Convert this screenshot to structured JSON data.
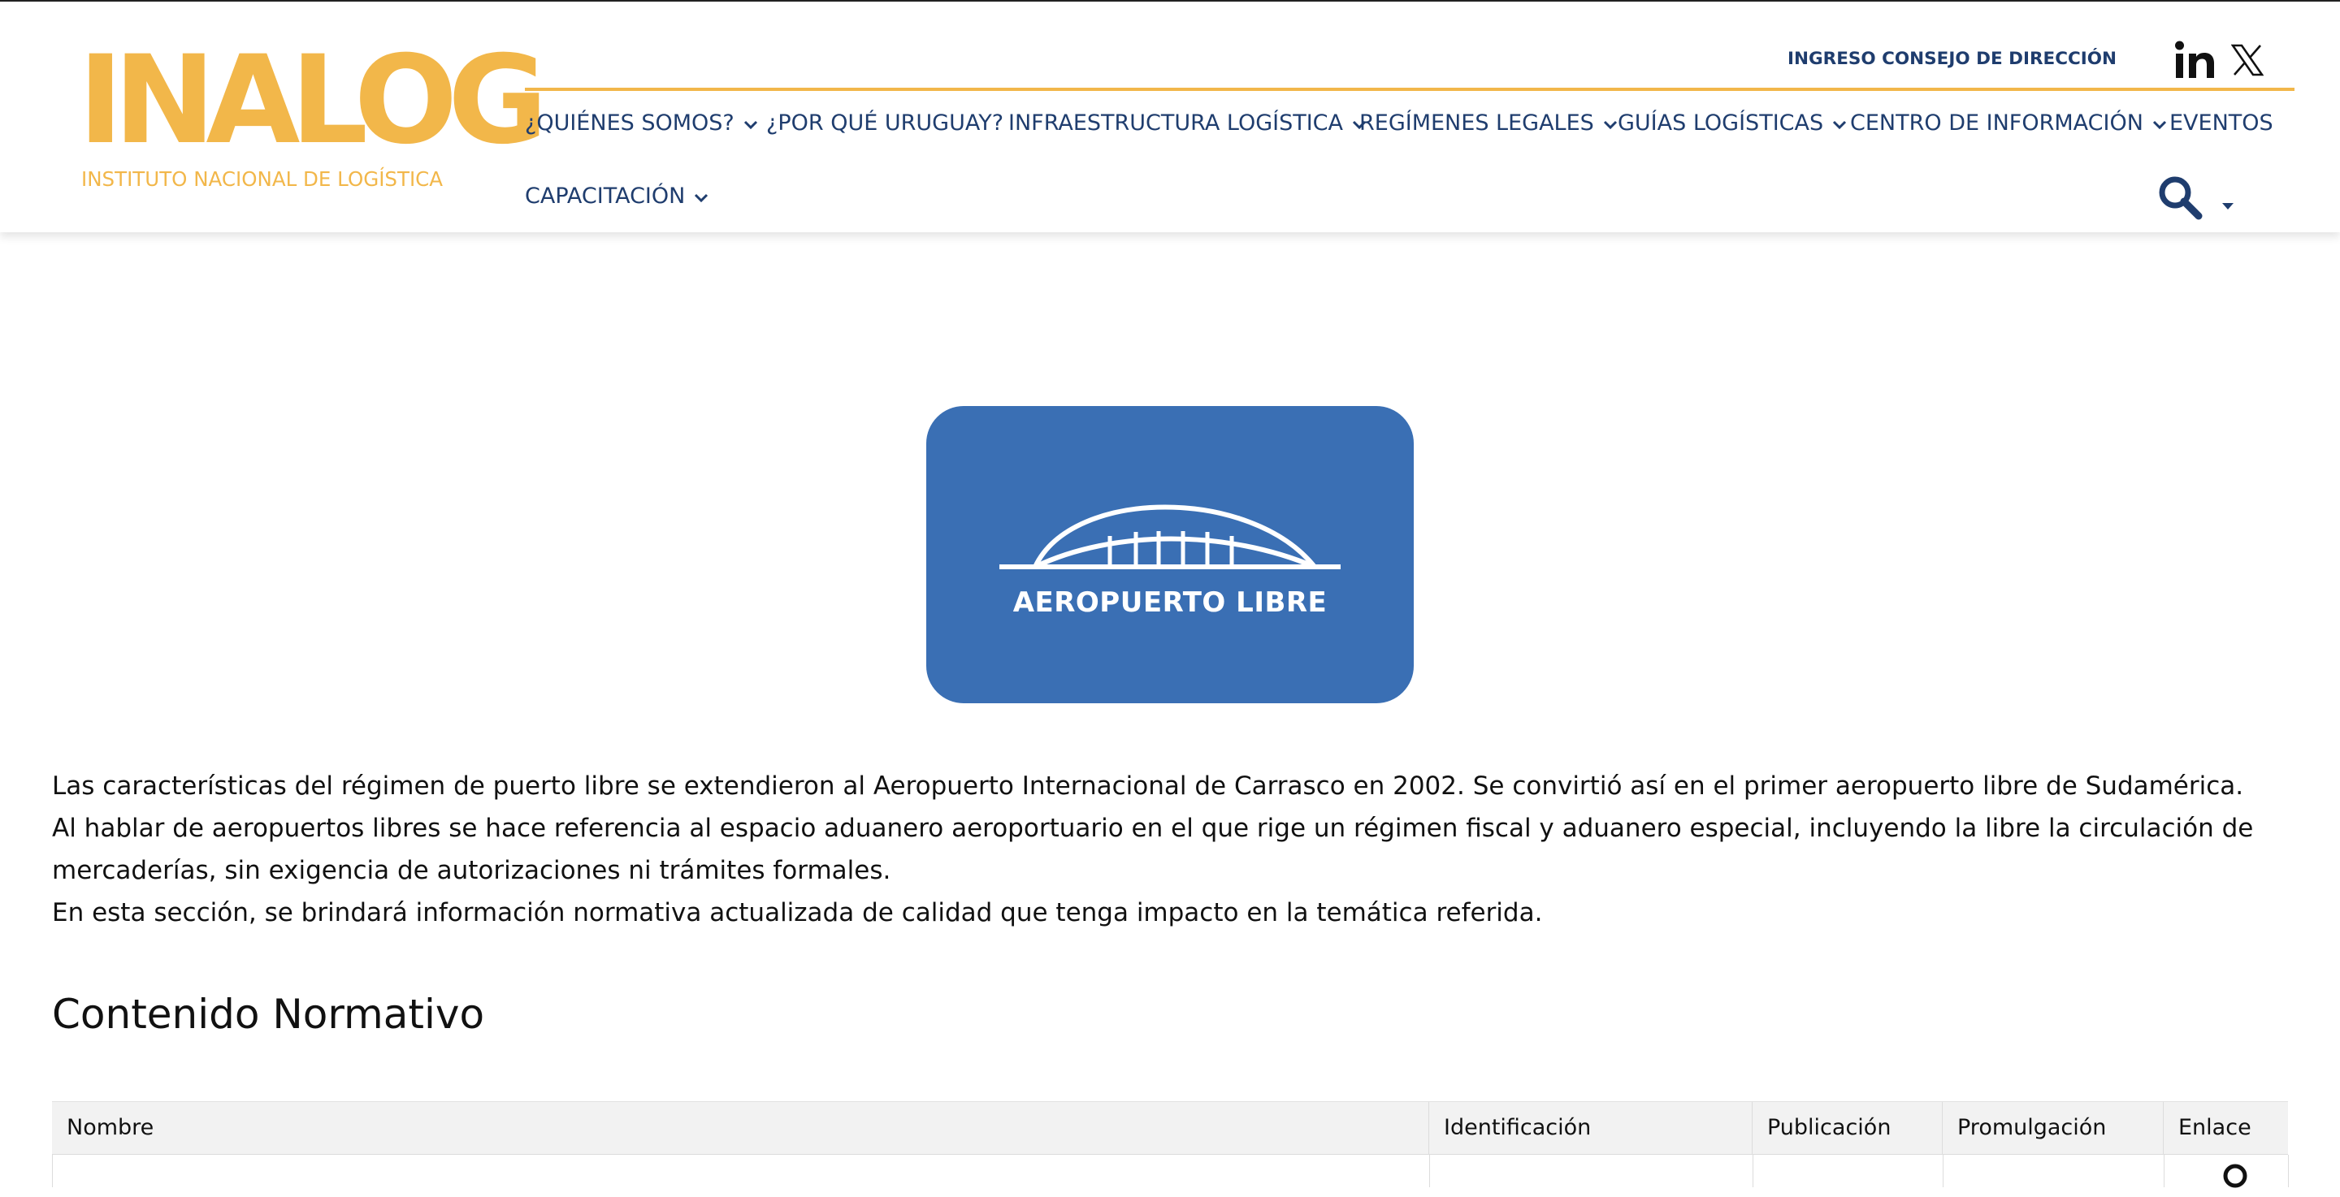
{
  "brand": {
    "logo_text": "INALOG",
    "logo_subtitle": "INSTITUTO NACIONAL DE LOGÍSTICA",
    "accent_color": "#f2b74a",
    "nav_color": "#1f3d6e"
  },
  "header": {
    "consejo_link": "INGRESO CONSEJO DE DIRECCIÓN",
    "social": [
      "linkedin-icon",
      "x-icon"
    ]
  },
  "nav": {
    "items": [
      {
        "label": "¿QUIÉNES SOMOS?",
        "has_dropdown": true
      },
      {
        "label": "¿POR QUÉ URUGUAY?",
        "has_dropdown": false
      },
      {
        "label": "INFRAESTRUCTURA LOGÍSTICA",
        "has_dropdown": true
      },
      {
        "label": "REGÍMENES LEGALES",
        "has_dropdown": true
      },
      {
        "label": "GUÍAS LOGÍSTICAS",
        "has_dropdown": true
      },
      {
        "label": "CENTRO DE INFORMACIÓN",
        "has_dropdown": true
      },
      {
        "label": "EVENTOS",
        "has_dropdown": false
      },
      {
        "label": "CAPACITACIÓN",
        "has_dropdown": true
      }
    ]
  },
  "hero": {
    "label": "AEROPUERTO LIBRE",
    "color": "#3a6fb4"
  },
  "content": {
    "paragraphs": [
      "Las características del régimen de puerto libre se extendieron al Aeropuerto Internacional de Carrasco en 2002. Se convirtió así en el primer aeropuerto libre de Sudamérica.",
      "Al hablar de aeropuertos libres se hace referencia al espacio aduanero aeroportuario en el que rige un régimen fiscal y aduanero especial, incluyendo la libre la circulación de mercaderías, sin exigencia de autorizaciones ni trámites formales.",
      "En esta sección, se brindará información normativa actualizada de calidad que tenga impacto en la temática referida."
    ],
    "section_title": "Contenido Normativo"
  },
  "table": {
    "headers": [
      "Nombre",
      "Identificación",
      "Publicación",
      "Promulgación",
      "Enlace"
    ]
  }
}
